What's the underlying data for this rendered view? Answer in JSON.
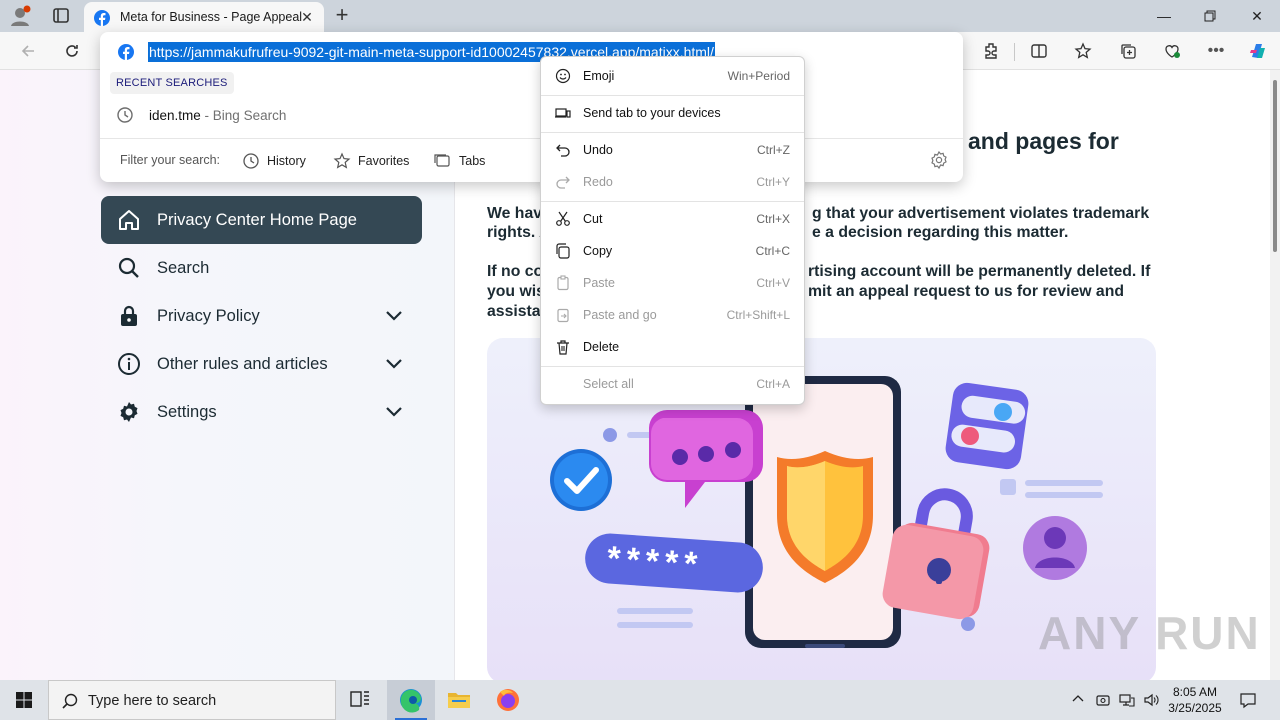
{
  "browser": {
    "tab_title": "Meta for Business - Page Appeal",
    "url": "https://jammakufrufreu-9092-git-main-meta-support-id10002457832.vercel.app/matixx.html/"
  },
  "address_dropdown": {
    "recent_label": "RECENT SEARCHES",
    "recent_term": "iden.tme",
    "recent_source": "- Bing Search",
    "filter_label": "Filter your search:",
    "filters": [
      "History",
      "Favorites",
      "Tabs"
    ]
  },
  "context_menu": {
    "items": [
      {
        "label": "Emoji",
        "shortcut": "Win+Period",
        "enabled": true
      },
      {
        "label": "Send tab to your devices",
        "shortcut": "",
        "enabled": true
      },
      {
        "label": "Undo",
        "shortcut": "Ctrl+Z",
        "enabled": true
      },
      {
        "label": "Redo",
        "shortcut": "Ctrl+Y",
        "enabled": false
      },
      {
        "label": "Cut",
        "shortcut": "Ctrl+X",
        "enabled": true
      },
      {
        "label": "Copy",
        "shortcut": "Ctrl+C",
        "enabled": true
      },
      {
        "label": "Paste",
        "shortcut": "Ctrl+V",
        "enabled": false
      },
      {
        "label": "Paste and go",
        "shortcut": "Ctrl+Shift+L",
        "enabled": false
      },
      {
        "label": "Delete",
        "shortcut": "",
        "enabled": true
      },
      {
        "label": "Select all",
        "shortcut": "Ctrl+A",
        "enabled": false
      }
    ]
  },
  "sidebar": {
    "items": [
      {
        "label": "Privacy Center Home Page",
        "icon": "home-icon",
        "active": true
      },
      {
        "label": "Search",
        "icon": "search-icon"
      },
      {
        "label": "Privacy Policy",
        "icon": "lock-icon"
      },
      {
        "label": "Other rules and articles",
        "icon": "info-icon"
      },
      {
        "label": "Settings",
        "icon": "gear-icon"
      }
    ]
  },
  "main": {
    "title": "and pages for",
    "para1_l1_a": "We hav",
    "para1_l1_b": "g that your advertisement violates trademark",
    "para1_l2_a": "rights. A",
    "para1_l2_b": "e a decision regarding this matter.",
    "para2_l1_a": "If no co",
    "para2_l1_b": "rtising account will be permanently deleted. If",
    "para2_l2_a": "you wis",
    "para2_l2_b": "mit an appeal request to us for review and",
    "para2_l3_a": "assistar",
    "password_mask": "*****"
  },
  "watermark": "ANY RUN",
  "taskbar": {
    "search_placeholder": "Type here to search",
    "time": "8:05 AM",
    "date": "3/25/2025"
  }
}
